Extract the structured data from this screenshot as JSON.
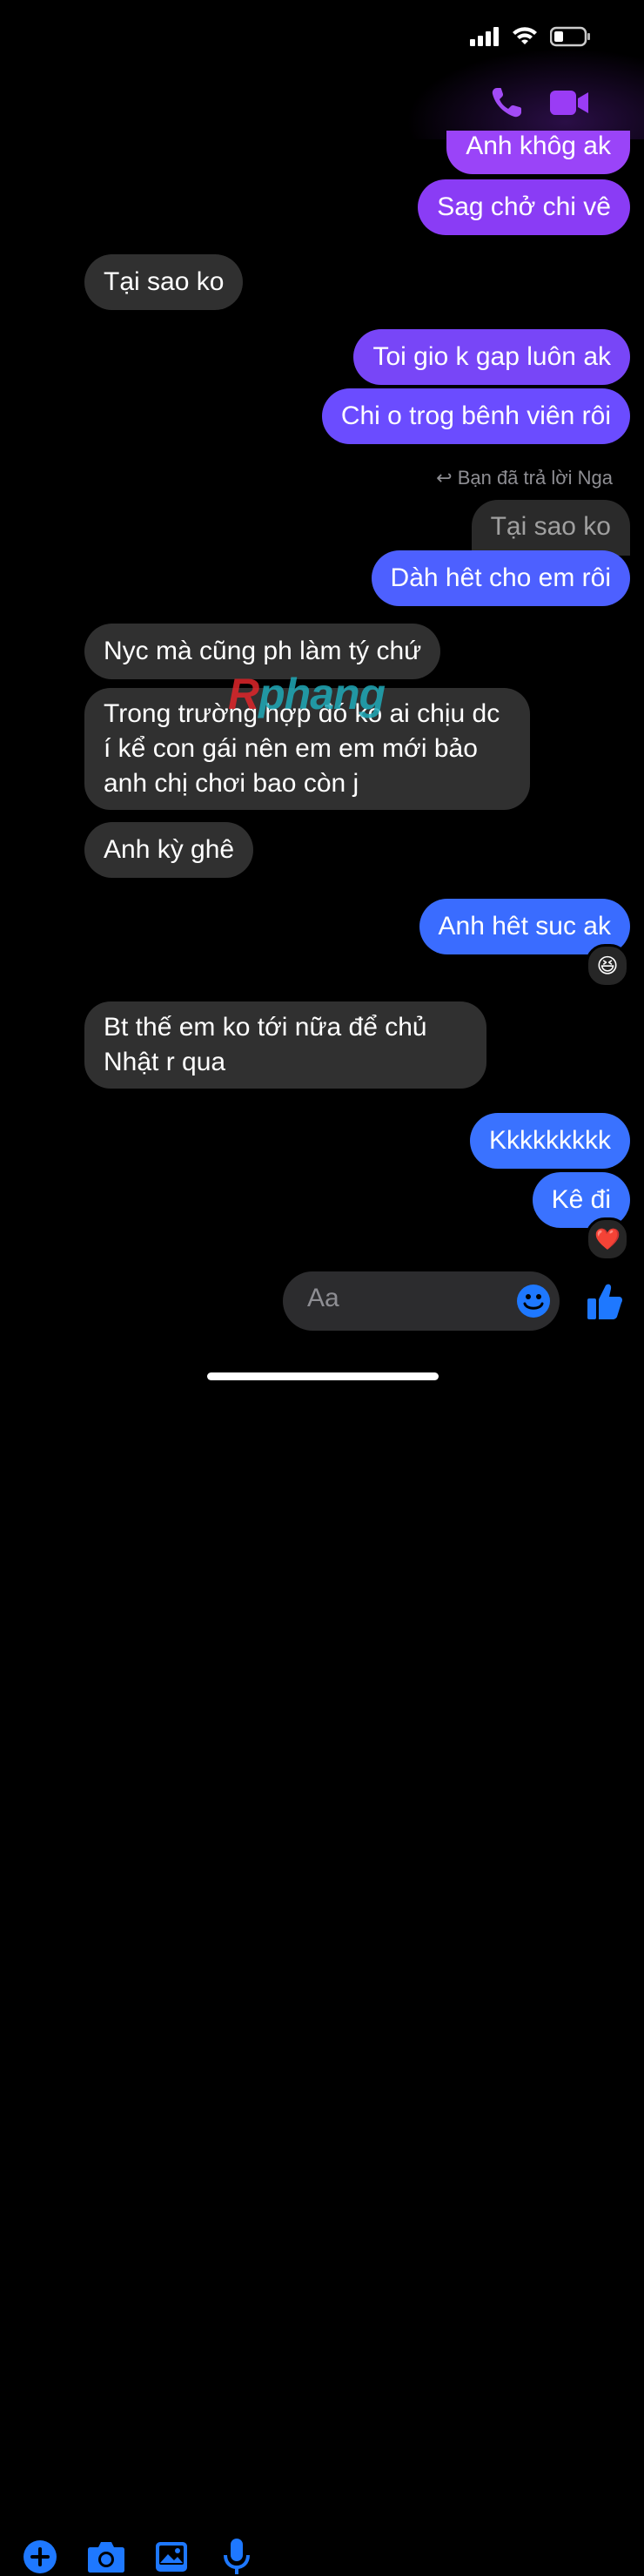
{
  "header": {
    "signal": "cellular-signal-icon",
    "wifi": "wifi-icon",
    "battery": "battery-icon",
    "call_icon": "phone-icon",
    "video_icon": "video-camera-icon"
  },
  "messages": {
    "m1": "Anh khôg ak",
    "m2": "Sag chở chi vê",
    "m3": "Tại sao ko",
    "m4": "Toi gio k gap luôn ak",
    "m5": "Chi o trog bênh viên rôi",
    "reply_label": "Bạn đã trả lời Nga",
    "quoted": "Tại sao ko",
    "m6": "Dàh hêt cho em rôi",
    "m7": "Nyc mà cũng ph làm tý chứ",
    "m8": "Trong trường hợp đó ko ai chịu dc í kể con gái nên em em mới bảo anh chị chơi bao còn j",
    "m9": "Anh kỳ ghê",
    "m10": "Anh hêt suc ak",
    "m10_reaction": "😆",
    "m11": "Bt thế em ko tới nữa để chủ Nhật r qua",
    "m12": "Kkkkkkkkk",
    "m13": "Kê đi",
    "m13_reaction": "❤️"
  },
  "watermark": {
    "first": "R",
    "rest": "phang"
  },
  "composer": {
    "placeholder": "Aa"
  },
  "colors": {
    "purple": "#8a3cf5",
    "violet": "#6b4cff",
    "blue": "#3a72ff",
    "incoming": "#303030",
    "accent_icons": "#1e78ff"
  }
}
